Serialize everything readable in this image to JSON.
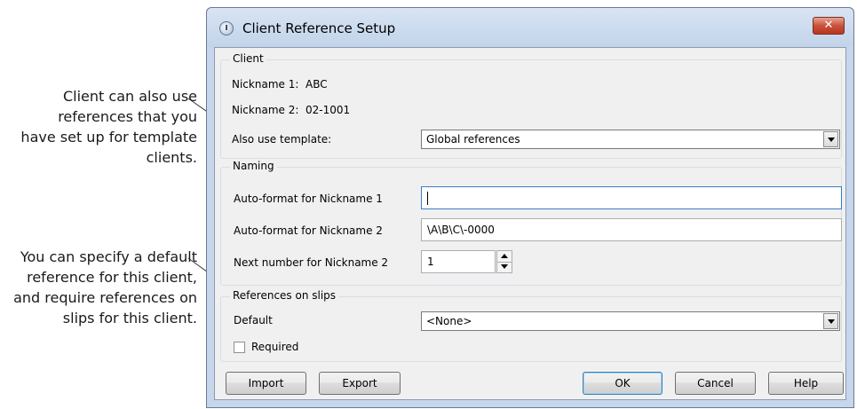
{
  "annotations": {
    "callout_1": "Client can also use references that you have set up for template clients.",
    "callout_2": "You can specify a default reference for this client, and require references on slips for this client."
  },
  "window": {
    "title": "Client Reference Setup",
    "close_glyph": "✕"
  },
  "client_group": {
    "label": "Client",
    "nickname1_label": "Nickname 1:",
    "nickname1_value": "ABC",
    "nickname2_label": "Nickname 2:",
    "nickname2_value": "02-1001",
    "template_label": "Also use template:",
    "template_value": "Global references"
  },
  "naming_group": {
    "label": "Naming",
    "autoformat1_label": "Auto-format for Nickname 1",
    "autoformat1_value": "",
    "autoformat2_label": "Auto-format for Nickname 2",
    "autoformat2_value": "\\A\\B\\C\\-0000",
    "next_number_label": "Next number for Nickname 2",
    "next_number_value": "1"
  },
  "references_group": {
    "label": "References on slips",
    "default_label": "Default",
    "default_value": "<None>",
    "required_label": "Required",
    "required_checked": false
  },
  "buttons": {
    "import": "Import",
    "export": "Export",
    "ok": "OK",
    "cancel": "Cancel",
    "help": "Help"
  },
  "icons": {
    "title": "clock-icon",
    "close": "close-icon",
    "dropdown": "chevron-down-icon",
    "spin_up": "spin-up-icon",
    "spin_down": "spin-down-icon"
  },
  "colors": {
    "close_button": "#c8513a",
    "frame": "#c6d6eb",
    "dialog_bg": "#f0f0f0",
    "focus_border": "#3d7bc7"
  }
}
